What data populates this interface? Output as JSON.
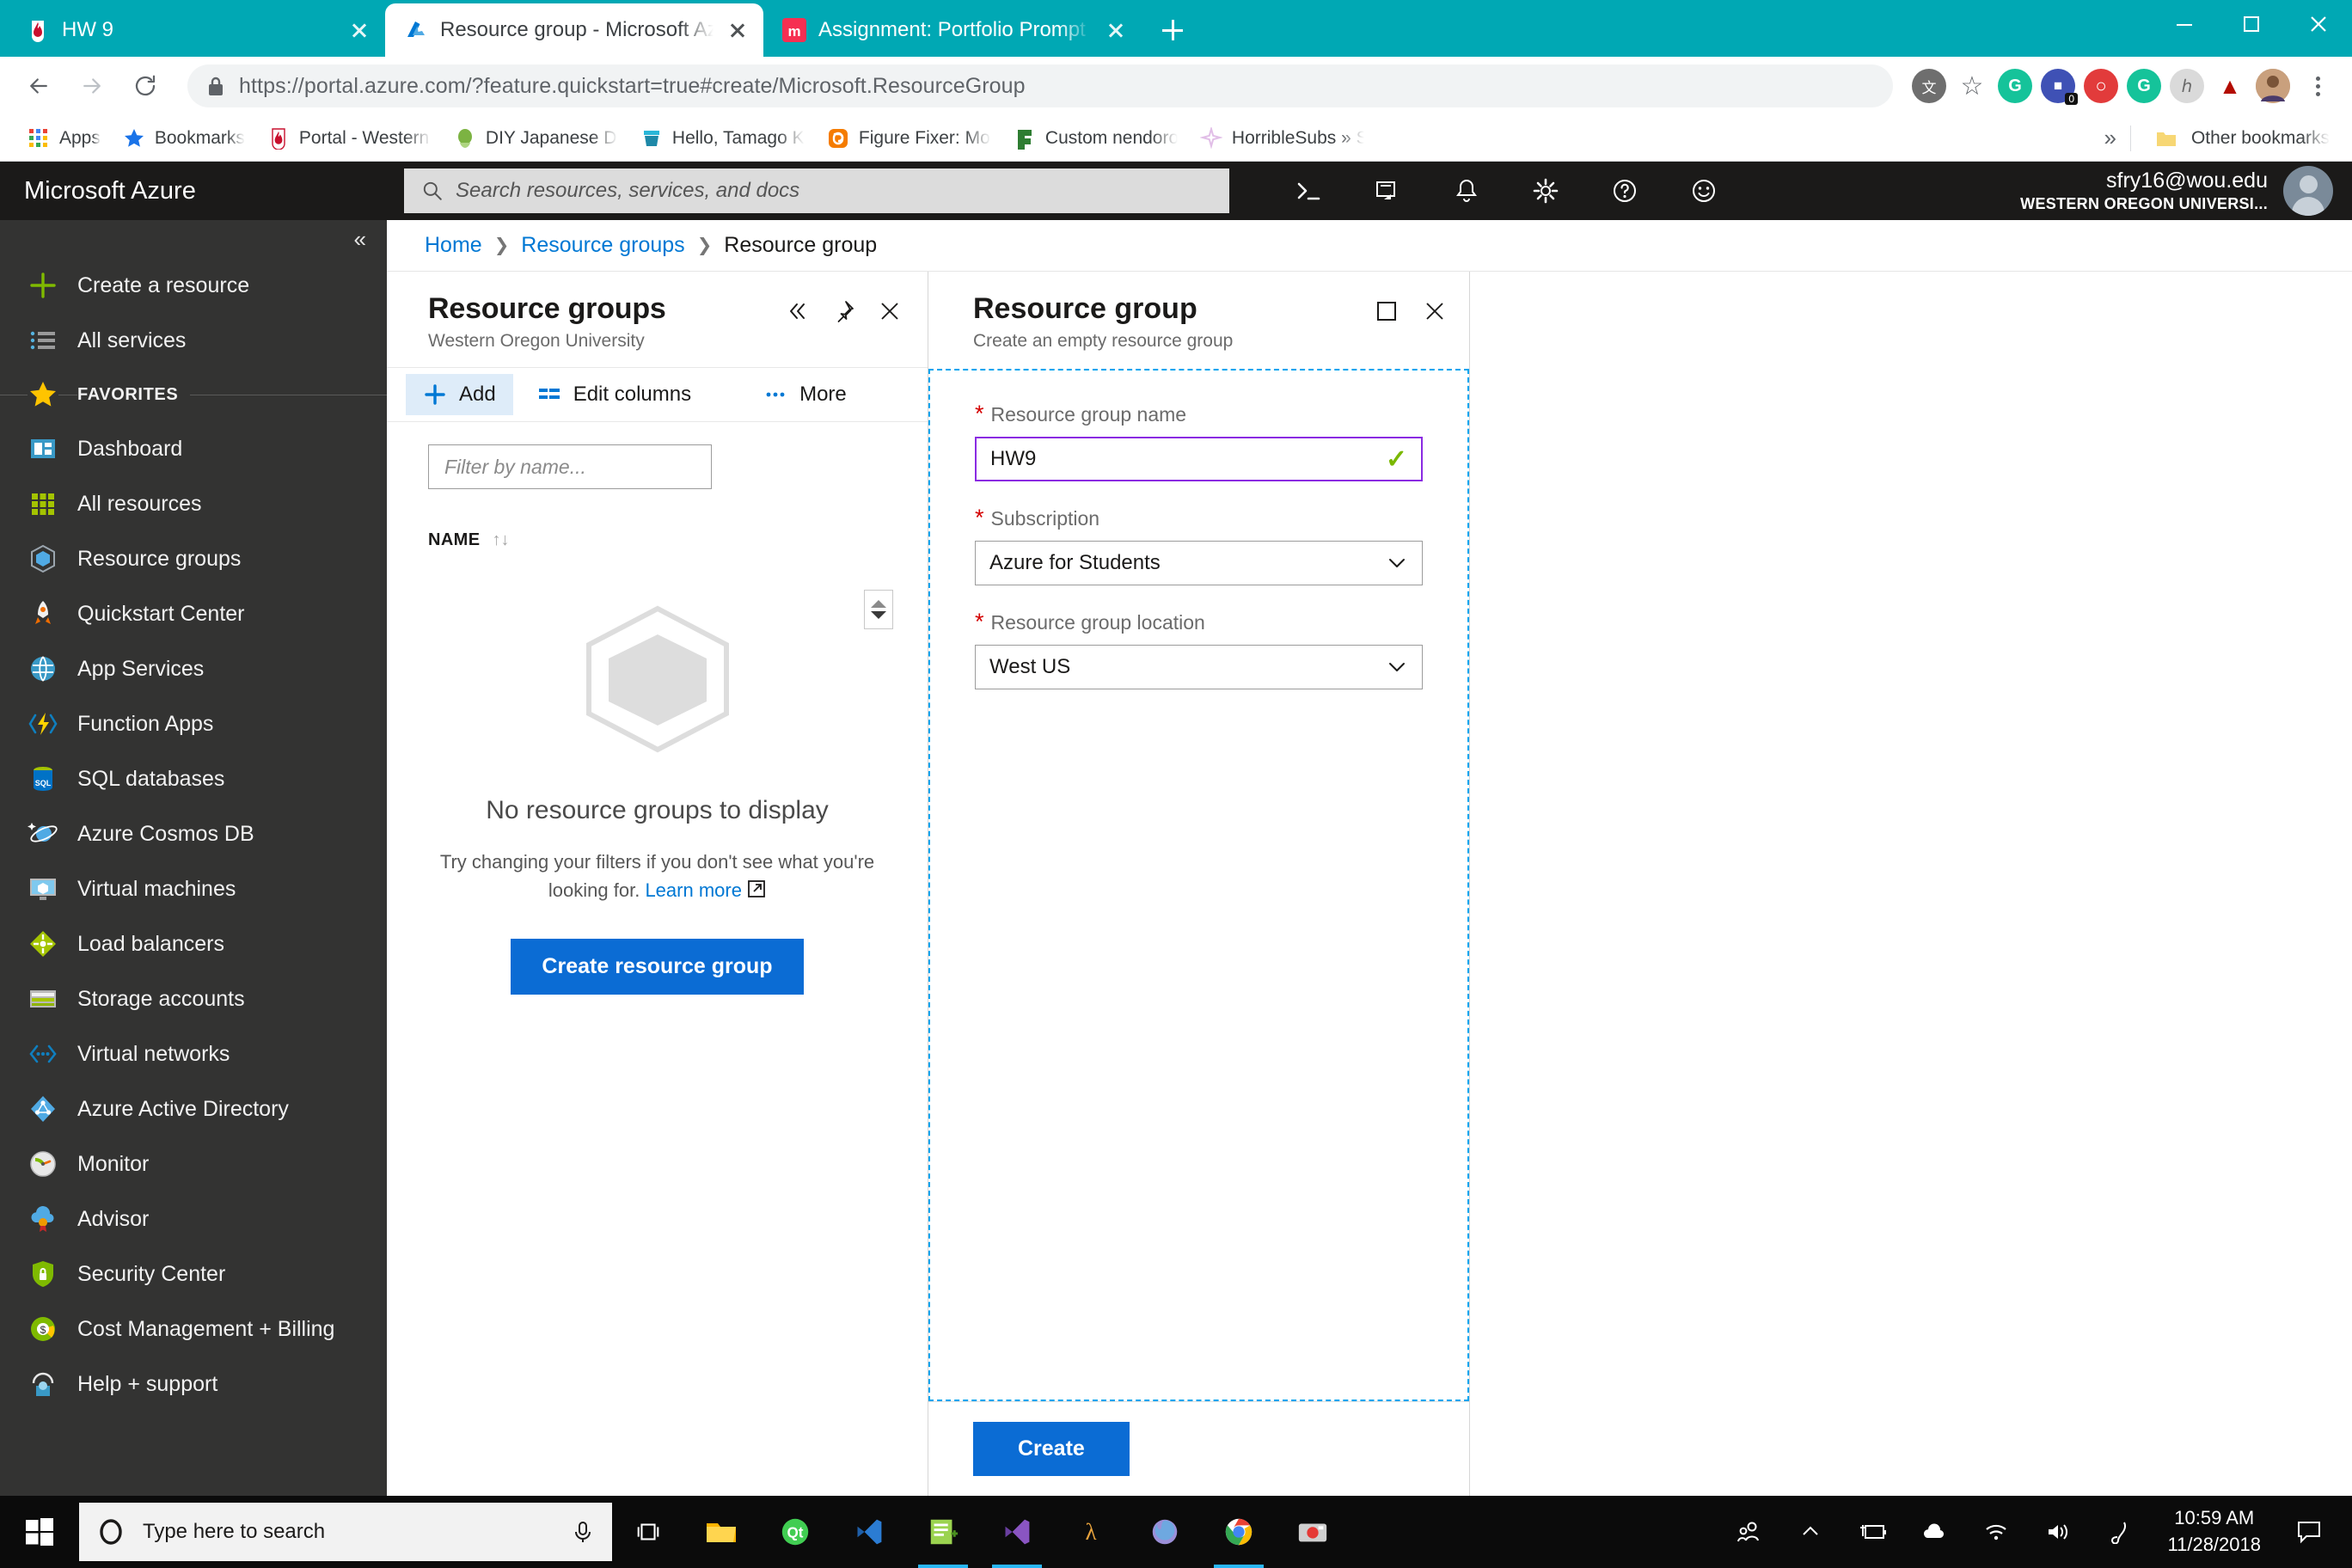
{
  "browser": {
    "tabs": [
      {
        "title": "HW 9",
        "favicon": "wou-flame-icon",
        "active": false
      },
      {
        "title": "Resource group - Microsoft Azure",
        "favicon": "azure-logo-icon",
        "active": true
      },
      {
        "title": "Assignment: Portfolio Prompt Nin",
        "favicon": "moodle-m-icon",
        "active": false
      }
    ],
    "new_tab_label": "+",
    "window_controls": [
      "minimize",
      "maximize",
      "close"
    ],
    "nav": {
      "back": "back-arrow",
      "forward": "forward-arrow",
      "reload": "reload-icon"
    },
    "url": {
      "scheme": "https://",
      "host": "portal.azure.com",
      "path": "/?feature.quickstart=true#create/Microsoft.ResourceGroup",
      "full": "https://portal.azure.com/?feature.quickstart=true#create/Microsoft.ResourceGroup"
    },
    "extensions": [
      {
        "name": "translate-icon",
        "color": "#777777",
        "glyph": "文"
      },
      {
        "name": "bookmark-star-icon",
        "color": "#5f6368",
        "glyph": "☆"
      },
      {
        "name": "grammarly-icon",
        "color": "#15c39a",
        "glyph": "G"
      },
      {
        "name": "notification-badge-icon",
        "color": "#4a5bd4",
        "glyph": "■",
        "badge": "0"
      },
      {
        "name": "opera-vpn-icon",
        "color": "#e23b3b",
        "glyph": "●"
      },
      {
        "name": "grammarly-green-icon",
        "color": "#15c39a",
        "glyph": "G"
      },
      {
        "name": "honey-icon",
        "color": "#d8d8d8",
        "glyph": "ħ"
      },
      {
        "name": "adobe-acrobat-icon",
        "color": "#b30b00",
        "glyph": "A"
      },
      {
        "name": "profile-avatar-icon",
        "color": "#b58a6c",
        "glyph": "●"
      }
    ],
    "menu_icon": "kebab-menu-icon",
    "bookmarks": [
      {
        "label": "Apps",
        "icon": "apps-grid-icon"
      },
      {
        "label": "Bookmarks",
        "icon": "star-icon"
      },
      {
        "label": "Portal - Western Oreg",
        "icon": "wou-flame-icon"
      },
      {
        "label": "DIY Japanese Dioram",
        "icon": "green-blob-icon"
      },
      {
        "label": "Hello, Tamago Kake G",
        "icon": "teal-bucket-icon"
      },
      {
        "label": "Figure Fixer: More Ab",
        "icon": "orange-blogger-icon"
      },
      {
        "label": "Custom nendoroid fa",
        "icon": "green-f-icon"
      },
      {
        "label": "HorribleSubs » So ba",
        "icon": "pink-sparkle-icon"
      }
    ],
    "bookmarks_overflow": "»",
    "other_bookmarks": {
      "label": "Other bookmarks",
      "icon": "folder-icon"
    }
  },
  "portal": {
    "brand": "Microsoft Azure",
    "search": {
      "placeholder": "Search resources, services, and docs",
      "icon": "search-icon"
    },
    "header_icons": [
      "cloud-shell-icon",
      "directory-filter-icon",
      "notifications-icon",
      "settings-gear-icon",
      "help-icon",
      "feedback-smiley-icon"
    ],
    "account": {
      "email": "sfry16@wou.edu",
      "org": "WESTERN OREGON UNIVERSI...",
      "avatar": "user-avatar-icon"
    },
    "sidebar": {
      "collapse_icon": "double-chevron-left-icon",
      "top_items": [
        {
          "label": "Create a resource",
          "icon": "plus-icon"
        },
        {
          "label": "All services",
          "icon": "list-icon"
        }
      ],
      "favorites_label": "FAVORITES",
      "favorites_icon": "star-icon",
      "items": [
        {
          "label": "Dashboard",
          "icon": "dashboard-icon"
        },
        {
          "label": "All resources",
          "icon": "grid-icon"
        },
        {
          "label": "Resource groups",
          "icon": "resource-group-cube-icon"
        },
        {
          "label": "Quickstart Center",
          "icon": "rocket-icon"
        },
        {
          "label": "App Services",
          "icon": "app-services-globe-icon"
        },
        {
          "label": "Function Apps",
          "icon": "function-lightning-icon"
        },
        {
          "label": "SQL databases",
          "icon": "sql-database-icon"
        },
        {
          "label": "Azure Cosmos DB",
          "icon": "cosmos-planet-icon"
        },
        {
          "label": "Virtual machines",
          "icon": "virtual-machine-monitor-icon"
        },
        {
          "label": "Load balancers",
          "icon": "load-balancer-icon"
        },
        {
          "label": "Storage accounts",
          "icon": "storage-account-icon"
        },
        {
          "label": "Virtual networks",
          "icon": "virtual-network-icon"
        },
        {
          "label": "Azure Active Directory",
          "icon": "active-directory-icon"
        },
        {
          "label": "Monitor",
          "icon": "monitor-gauge-icon"
        },
        {
          "label": "Advisor",
          "icon": "advisor-cloud-icon"
        },
        {
          "label": "Security Center",
          "icon": "security-shield-icon"
        },
        {
          "label": "Cost Management + Billing",
          "icon": "cost-management-icon"
        },
        {
          "label": "Help + support",
          "icon": "help-support-icon"
        }
      ]
    },
    "breadcrumb": [
      {
        "label": "Home",
        "current": false
      },
      {
        "label": "Resource groups",
        "current": false
      },
      {
        "label": "Resource group",
        "current": true
      }
    ],
    "blade_list": {
      "title": "Resource groups",
      "subtitle": "Western Oregon University",
      "actions": [
        "collapse-icon",
        "pin-icon",
        "close-icon"
      ],
      "commands": [
        {
          "label": "Add",
          "icon": "plus-icon",
          "active": true
        },
        {
          "label": "Edit columns",
          "icon": "columns-icon",
          "active": false
        },
        {
          "label": "More",
          "icon": "ellipsis-icon",
          "active": false
        }
      ],
      "filter_placeholder": "Filter by name...",
      "column_header": "NAME",
      "sort_icon": "sort-arrows-icon",
      "empty_title": "No resource groups to display",
      "empty_body_1": "Try changing your filters if you don't see what you're",
      "empty_body_2": "looking for.",
      "empty_link": "Learn more",
      "external_link_icon": "external-link-icon",
      "empty_button": "Create resource group",
      "illustration": "empty-cube-icon"
    },
    "blade_create": {
      "title": "Resource group",
      "subtitle": "Create an empty resource group",
      "actions": [
        "maximize-icon",
        "close-icon"
      ],
      "fields": [
        {
          "label": "Resource group name",
          "required": true,
          "type": "text",
          "value": "HW9",
          "validated": true,
          "validation_icon": "green-check-icon"
        },
        {
          "label": "Subscription",
          "required": true,
          "type": "select",
          "value": "Azure for Students",
          "chevron": "chevron-down-icon"
        },
        {
          "label": "Resource group location",
          "required": true,
          "type": "select",
          "value": "West US",
          "chevron": "chevron-down-icon"
        }
      ],
      "submit_label": "Create"
    }
  },
  "taskbar": {
    "start_icon": "windows-start-icon",
    "search_placeholder": "Type here to search",
    "cortana_icon": "cortana-circle-icon",
    "mic_icon": "microphone-icon",
    "taskview_icon": "task-view-icon",
    "apps": [
      {
        "name": "file-explorer-icon",
        "running": false
      },
      {
        "name": "qt-creator-icon",
        "running": false
      },
      {
        "name": "vscode-icon",
        "running": false
      },
      {
        "name": "notepad-plus-plus-icon",
        "running": true
      },
      {
        "name": "visual-studio-icon",
        "running": true
      },
      {
        "name": "lambda-haskell-icon",
        "running": false
      },
      {
        "name": "firefox-icon",
        "running": false
      },
      {
        "name": "chrome-icon",
        "running": true
      },
      {
        "name": "camera-app-icon",
        "running": false
      }
    ],
    "tray": [
      "people-icon",
      "show-hidden-icons-chevron",
      "battery-charging-icon",
      "onedrive-cloud-icon",
      "wifi-icon",
      "volume-icon",
      "pen-workspace-icon"
    ],
    "clock": {
      "time": "10:59 AM",
      "date": "11/28/2018"
    },
    "action_center_icon": "action-center-icon"
  }
}
